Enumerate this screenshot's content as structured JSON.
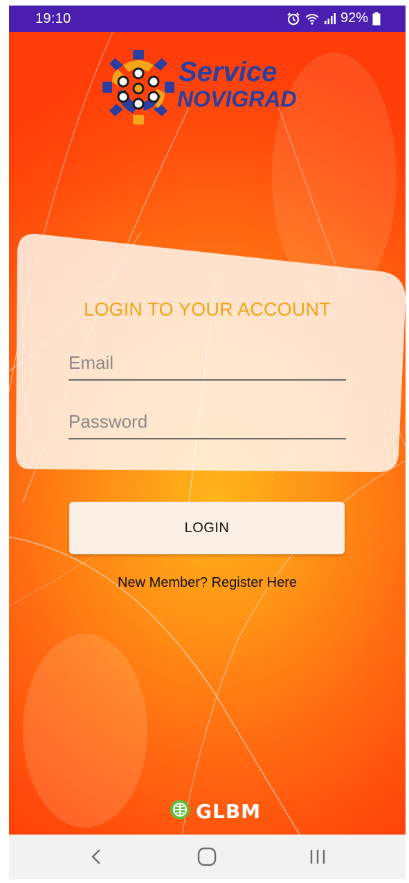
{
  "status_bar": {
    "time": "19:10",
    "battery": "92%",
    "icons": [
      "alarm-icon",
      "wifi-icon",
      "signal-icon",
      "battery-icon"
    ]
  },
  "logo": {
    "title": "Service",
    "subtitle": "NOVIGRAD",
    "icon": "gear-logo-icon",
    "color": "#2a3fa0"
  },
  "login_card": {
    "heading": "LOGIN TO YOUR ACCOUNT",
    "heading_color": "#f0a418",
    "email_placeholder": "Email",
    "email_value": "",
    "password_placeholder": "Password",
    "password_value": ""
  },
  "actions": {
    "login_label": "LOGIN",
    "register_label": "New Member? Register Here"
  },
  "footer": {
    "brand": "GLBM",
    "icon": "globe-icon"
  },
  "nav_bar": {
    "icons": [
      "back-icon",
      "home-icon",
      "recents-icon"
    ]
  },
  "colors": {
    "status_bar": "#4a1fb0",
    "background_center": "#ffb51a",
    "background_edge": "#ff3d08",
    "card": "#fdf3ea"
  }
}
